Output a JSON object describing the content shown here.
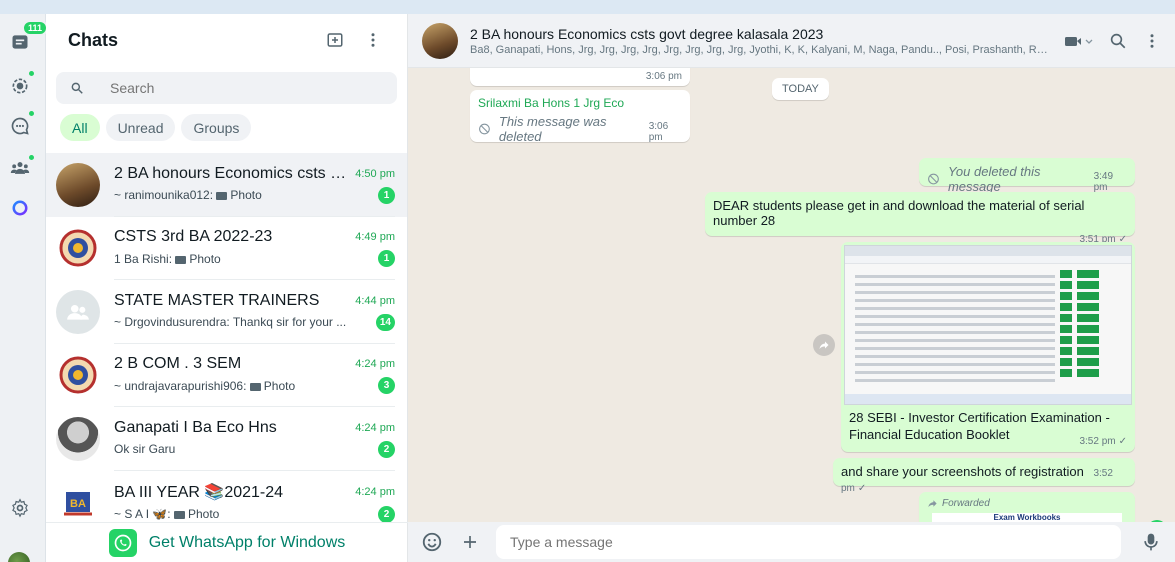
{
  "rail": {
    "chats_badge": "111"
  },
  "list": {
    "title": "Chats",
    "search_placeholder": "Search",
    "filters": [
      "All",
      "Unread",
      "Groups"
    ],
    "chats": [
      {
        "name": "2 BA honours Economics csts g...",
        "time": "4:50 pm",
        "preview": "~ ranimounika012:",
        "media": "Photo",
        "unread": "1"
      },
      {
        "name": "CSTS  3rd BA 2022-23",
        "time": "4:49 pm",
        "preview": "1 Ba Rishi:",
        "media": "Photo",
        "unread": "1"
      },
      {
        "name": "STATE MASTER TRAINERS",
        "time": "4:44 pm",
        "preview": "~ Drgovindusurendra: Thankq sir for your ...",
        "media": "",
        "unread": "14"
      },
      {
        "name": "2 B COM . 3 SEM",
        "time": "4:24 pm",
        "preview": "~ undrajavarapurishi906:",
        "media": "Photo",
        "unread": "3"
      },
      {
        "name": "Ganapati I Ba Eco Hns",
        "time": "4:24 pm",
        "preview": "Ok sir Garu",
        "media": "",
        "unread": "2"
      },
      {
        "name": "BA III YEAR 📚2021-24",
        "time": "4:24 pm",
        "preview": "~ S A I 🦋:",
        "media": "Photo",
        "unread": "2"
      }
    ],
    "get_whatsapp": "Get WhatsApp for Windows"
  },
  "convo": {
    "title": "2 BA honours Economics csts govt degree kalasala 2023",
    "members": "Ba8, Ganapati, Hons, Jrg, Jrg, Jrg, Jrg, Jrg, Jrg, Jrg, Jrg, Jyothi, K, K, Kalyani, M, Naga, Pandu.., Posi, Prashanth, Ren...",
    "messages": {
      "first_time": "3:06 pm",
      "today_label": "TODAY",
      "deleted_sender": "Srilaxmi Ba Hons 1 Jrg Eco",
      "deleted_text": "This message was deleted",
      "deleted_time": "3:06 pm",
      "you_deleted": "You deleted this message",
      "you_deleted_time": "3:49 pm",
      "dear_text": "DEAR students please get in and download the material of serial number 28",
      "dear_time": "3:51 pm",
      "image_caption": "28    SEBI - Investor Certification Examination - Financial Education Booklet",
      "image_time": "3:52 pm",
      "share_text": "and share your screenshots of registration",
      "share_time": "3:52 pm",
      "forwarded_label": "Forwarded",
      "forwarded_preview": "Exam Workbooks"
    },
    "new_count": "1",
    "composer_placeholder": "Type a message"
  }
}
